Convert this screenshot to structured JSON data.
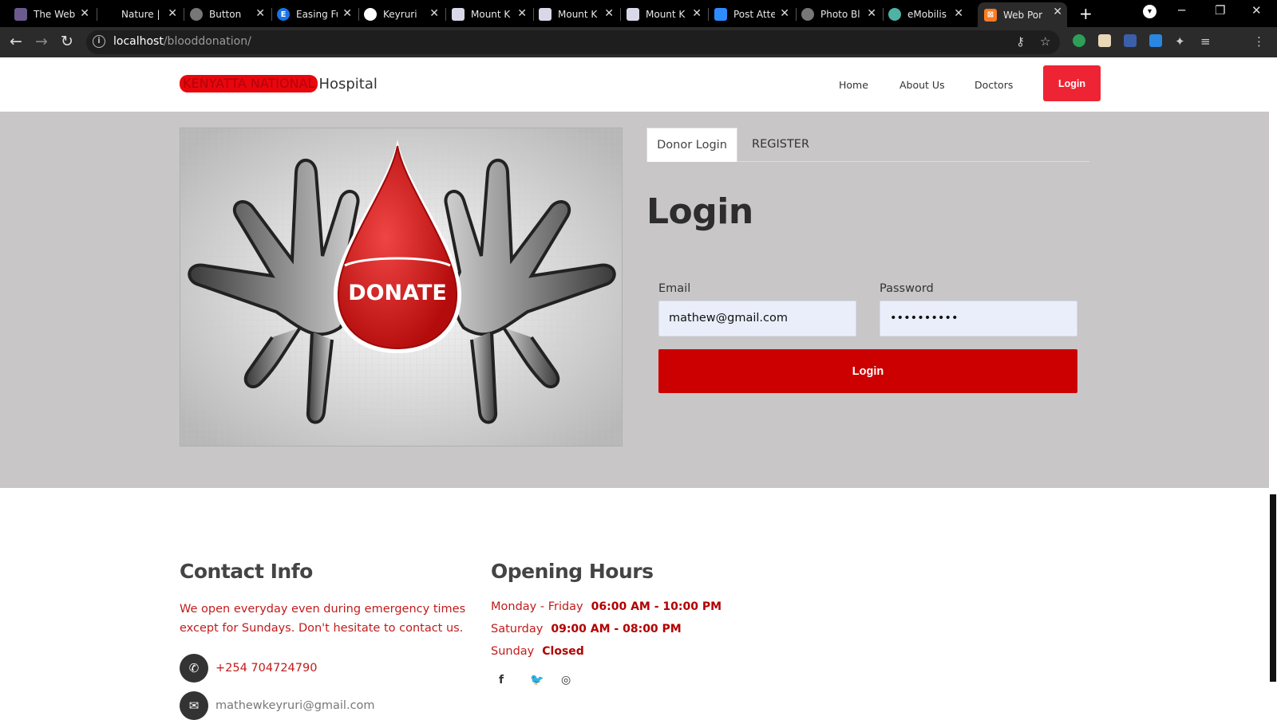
{
  "browser": {
    "tabs": [
      {
        "title": "The Web",
        "icon": "image-icon",
        "color": "#6b5a8e"
      },
      {
        "title": "Nature |",
        "icon": "blank-icon",
        "color": "#000000"
      },
      {
        "title": "Button",
        "icon": "globe-icon",
        "color": "#777777"
      },
      {
        "title": "Easing Fu",
        "icon": "e-icon",
        "color": "#1a73e8"
      },
      {
        "title": "Keyruri",
        "icon": "github-icon",
        "color": "#ffffff"
      },
      {
        "title": "Mount K",
        "icon": "crest-icon",
        "color": "#d8d8e8"
      },
      {
        "title": "Mount K",
        "icon": "crest-icon",
        "color": "#d8d8e8"
      },
      {
        "title": "Mount K",
        "icon": "crest-icon",
        "color": "#d8d8e8"
      },
      {
        "title": "Post Atte",
        "icon": "zoom-icon",
        "color": "#2d8cff"
      },
      {
        "title": "Photo Bl",
        "icon": "globe-icon",
        "color": "#777777"
      },
      {
        "title": "eMobilis",
        "icon": "circle-icon",
        "color": "#4fb3a3"
      },
      {
        "title": "Web Por",
        "icon": "xampp-icon",
        "color": "#fb7a24"
      }
    ],
    "url_host": "localhost",
    "url_path": "/blooddonation/"
  },
  "header": {
    "brand_highlight": "KENYATTA NATIONAL",
    "brand_rest": "Hospital",
    "nav": [
      "Home",
      "About Us",
      "Doctors"
    ],
    "login_button": "Login"
  },
  "hero": {
    "image_text": "DONATE",
    "tabs": {
      "active": "Donor Login",
      "inactive": "REGISTER"
    },
    "title": "Login",
    "email_label": "Email",
    "email_value": "mathew@gmail.com",
    "password_label": "Password",
    "password_value": "••••••••••",
    "submit_label": "Login"
  },
  "footer": {
    "contact": {
      "heading": "Contact Info",
      "text": "We open everyday even during emergency times except for Sundays. Don't hesitate to contact us.",
      "phone": "+254 704724790",
      "email": "mathewkeyruri@gmail.com"
    },
    "hours": {
      "heading": "Opening Hours",
      "rows": [
        {
          "day": "Monday - Friday",
          "time": "06:00 AM - 10:00 PM"
        },
        {
          "day": "Saturday",
          "time": "09:00 AM - 08:00 PM"
        },
        {
          "day": "Sunday",
          "time": "Closed"
        }
      ]
    },
    "social_icons": [
      "facebook-icon",
      "twitter-icon",
      "instagram-icon"
    ]
  },
  "colors": {
    "brand_red": "#ee2434",
    "submit_red": "#cc0000",
    "text_red": "#c21b1b",
    "section_grey": "#c8c6c7"
  }
}
